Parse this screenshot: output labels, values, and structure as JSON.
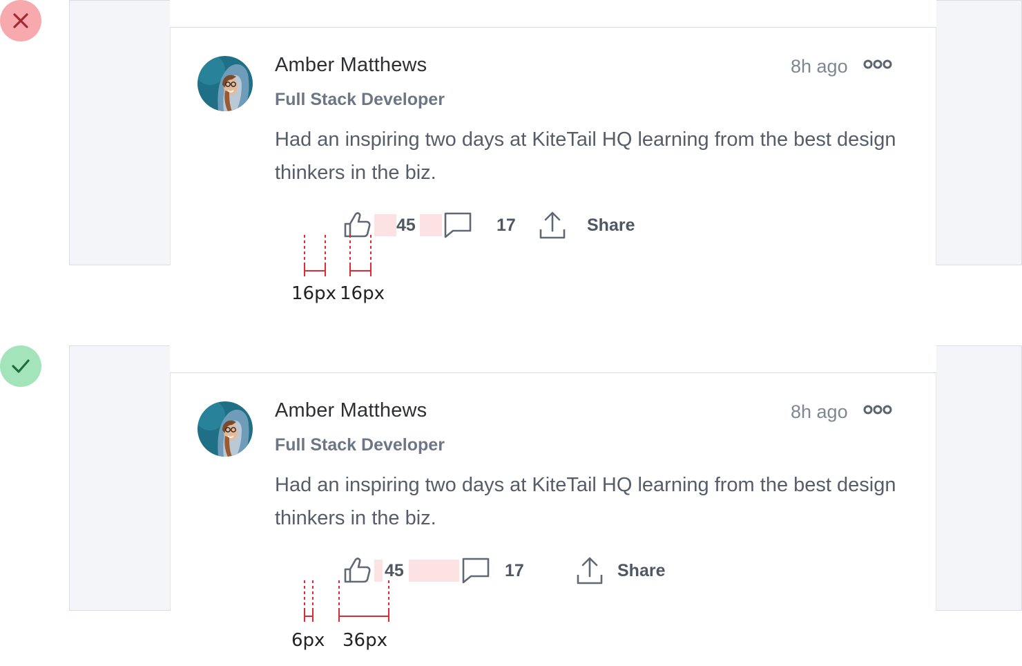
{
  "examples": [
    {
      "verdict": "incorrect",
      "verdict_icon": "x-icon",
      "post": {
        "author_name": "Amber Matthews",
        "author_role": "Full Stack Developer",
        "timestamp": "8h ago",
        "body": "Had an inspiring two days at KiteTail HQ learning from the best design thinkers in the biz.",
        "like_count": "45",
        "comment_count": "17",
        "share_label": "Share"
      },
      "measurements": [
        "16px",
        "16px"
      ]
    },
    {
      "verdict": "correct",
      "verdict_icon": "check-icon",
      "post": {
        "author_name": "Amber Matthews",
        "author_role": "Full Stack Developer",
        "timestamp": "8h ago",
        "body": "Had an inspiring two days at KiteTail HQ learning from the best design thinkers in the biz.",
        "like_count": "45",
        "comment_count": "17",
        "share_label": "Share"
      },
      "measurements": [
        "6px",
        "36px"
      ]
    }
  ],
  "colors": {
    "incorrect_badge": "#f7a9ad",
    "correct_badge": "#a3e4bb",
    "highlight": "#fde2e4",
    "measure_line": "#e0282e"
  }
}
